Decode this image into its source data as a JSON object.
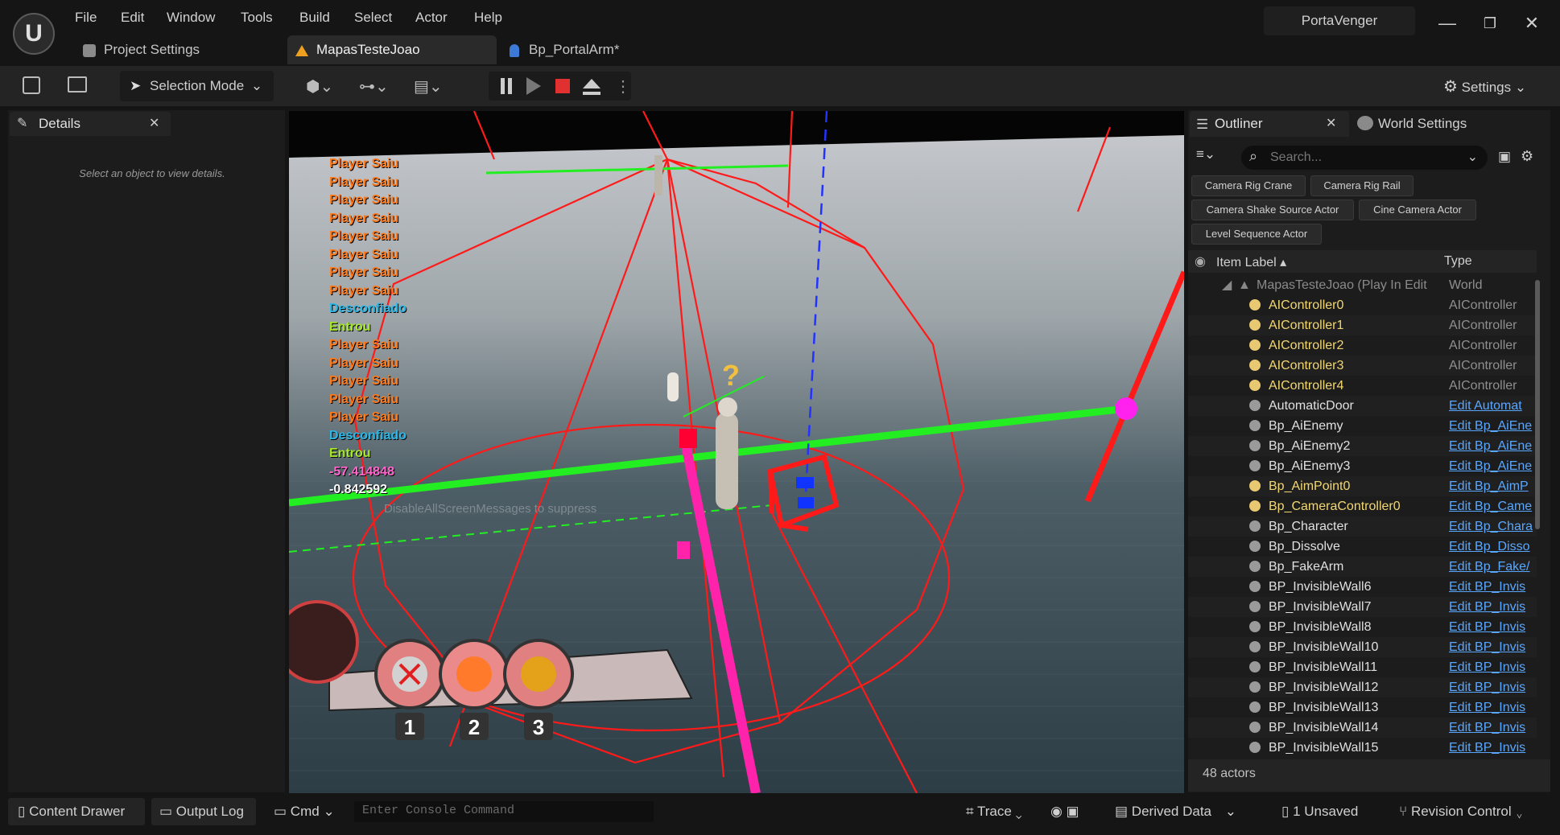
{
  "app": {
    "logo_text": "U",
    "project_name": "PortaVenger"
  },
  "menu": [
    "File",
    "Edit",
    "Window",
    "Tools",
    "Build",
    "Select",
    "Actor",
    "Help"
  ],
  "tabs": [
    {
      "label": "Project Settings"
    },
    {
      "label": "MapasTesteJoao"
    },
    {
      "label": "Bp_PortalArm*"
    }
  ],
  "toolbar": {
    "mode_label": "Selection Mode",
    "settings_label": "Settings"
  },
  "details": {
    "title": "Details",
    "empty_text": "Select an object to view details."
  },
  "viewport": {
    "messages": [
      {
        "text": "Player Saiu",
        "color": "#ff7a1a"
      },
      {
        "text": "Player Saiu",
        "color": "#ff7a1a"
      },
      {
        "text": "Player Saiu",
        "color": "#ff7a1a"
      },
      {
        "text": "Player Saiu",
        "color": "#ff7a1a"
      },
      {
        "text": "Player Saiu",
        "color": "#ff7a1a"
      },
      {
        "text": "Player Saiu",
        "color": "#ff7a1a"
      },
      {
        "text": "Player Saiu",
        "color": "#ff7a1a"
      },
      {
        "text": "Player Saiu",
        "color": "#ff7a1a"
      },
      {
        "text": "Desconfiado",
        "color": "#2ab8e8"
      },
      {
        "text": "Entrou",
        "color": "#a8e82a"
      },
      {
        "text": "Player Saiu",
        "color": "#ff7a1a"
      },
      {
        "text": "Player Saiu",
        "color": "#ff7a1a"
      },
      {
        "text": "Player Saiu",
        "color": "#ff7a1a"
      },
      {
        "text": "Player Saiu",
        "color": "#ff7a1a"
      },
      {
        "text": "Player Saiu",
        "color": "#ff7a1a"
      },
      {
        "text": "Desconfiado",
        "color": "#2ab8e8"
      },
      {
        "text": "Entrou",
        "color": "#a8e82a"
      },
      {
        "text": "-57.414848",
        "color": "#ff66cc"
      },
      {
        "text": "-0.842592",
        "color": "#ffffff"
      }
    ],
    "hint_text": "DisableAllScreenMessages to suppress",
    "hud_slots": [
      "1",
      "2",
      "3"
    ],
    "question_mark": "?"
  },
  "outliner": {
    "title": "Outliner",
    "world_settings_label": "World Settings",
    "search_placeholder": "Search...",
    "chips": [
      "Camera Rig Crane",
      "Camera Rig Rail",
      "Camera Shake Source Actor",
      "Cine Camera Actor",
      "Level Sequence Actor"
    ],
    "col_label": "Item Label",
    "col_type": "Type",
    "root": {
      "label": "MapasTesteJoao (Play In Edit",
      "type": "World"
    },
    "rows": [
      {
        "label": "AIController0",
        "type": "AIController",
        "yellow": true,
        "link": false
      },
      {
        "label": "AIController1",
        "type": "AIController",
        "yellow": true,
        "link": false
      },
      {
        "label": "AIController2",
        "type": "AIController",
        "yellow": true,
        "link": false
      },
      {
        "label": "AIController3",
        "type": "AIController",
        "yellow": true,
        "link": false
      },
      {
        "label": "AIController4",
        "type": "AIController",
        "yellow": true,
        "link": false
      },
      {
        "label": "AutomaticDoor",
        "type": "Edit Automat",
        "yellow": false,
        "link": true
      },
      {
        "label": "Bp_AiEnemy",
        "type": "Edit Bp_AiEne",
        "yellow": false,
        "link": true
      },
      {
        "label": "Bp_AiEnemy2",
        "type": "Edit Bp_AiEne",
        "yellow": false,
        "link": true
      },
      {
        "label": "Bp_AiEnemy3",
        "type": "Edit Bp_AiEne",
        "yellow": false,
        "link": true
      },
      {
        "label": "Bp_AimPoint0",
        "type": "Edit Bp_AimP",
        "yellow": true,
        "link": true
      },
      {
        "label": "Bp_CameraController0",
        "type": "Edit Bp_Came",
        "yellow": true,
        "link": true
      },
      {
        "label": "Bp_Character",
        "type": "Edit Bp_Chara",
        "yellow": false,
        "link": true
      },
      {
        "label": "Bp_Dissolve",
        "type": "Edit Bp_Disso",
        "yellow": false,
        "link": true
      },
      {
        "label": "Bp_FakeArm",
        "type": "Edit Bp_Fake/",
        "yellow": false,
        "link": true
      },
      {
        "label": "BP_InvisibleWall6",
        "type": "Edit BP_Invis",
        "yellow": false,
        "link": true
      },
      {
        "label": "BP_InvisibleWall7",
        "type": "Edit BP_Invis",
        "yellow": false,
        "link": true
      },
      {
        "label": "BP_InvisibleWall8",
        "type": "Edit BP_Invis",
        "yellow": false,
        "link": true
      },
      {
        "label": "BP_InvisibleWall10",
        "type": "Edit BP_Invis",
        "yellow": false,
        "link": true
      },
      {
        "label": "BP_InvisibleWall11",
        "type": "Edit BP_Invis",
        "yellow": false,
        "link": true
      },
      {
        "label": "BP_InvisibleWall12",
        "type": "Edit BP_Invis",
        "yellow": false,
        "link": true
      },
      {
        "label": "BP_InvisibleWall13",
        "type": "Edit BP_Invis",
        "yellow": false,
        "link": true
      },
      {
        "label": "BP_InvisibleWall14",
        "type": "Edit BP_Invis",
        "yellow": false,
        "link": true
      },
      {
        "label": "BP_InvisibleWall15",
        "type": "Edit BP_Invis",
        "yellow": false,
        "link": true
      }
    ],
    "actor_count": "48 actors"
  },
  "statusbar": {
    "content_drawer": "Content Drawer",
    "output_log": "Output Log",
    "cmd": "Cmd",
    "console_placeholder": "Enter Console Command",
    "trace": "Trace",
    "derived_data": "Derived Data",
    "unsaved": "1 Unsaved",
    "revision_control": "Revision Control"
  }
}
